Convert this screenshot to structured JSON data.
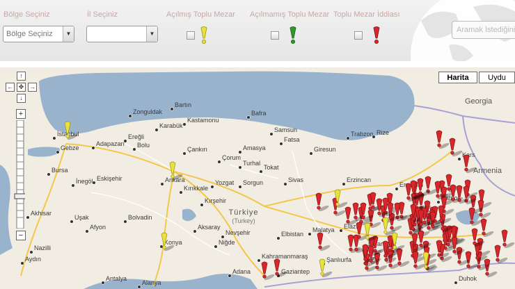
{
  "filters": {
    "region_label": "Bölge Seçiniz",
    "region_value": "Bölge Seçiniz",
    "province_label": "İl Seçiniz",
    "province_value": "",
    "opened_label": "Açılmış Toplu Mezar",
    "unopened_label": "Açılmamış Toplu Mezar",
    "claim_label": "Toplu Mezar İddiası"
  },
  "search": {
    "placeholder": "Aramak İstediğiniz"
  },
  "map_type": {
    "map_label": "Harita",
    "satellite_label": "Uydu"
  },
  "colors": {
    "opened_pin": "#e8e23a",
    "unopened_pin": "#2e9a2e",
    "claim_pin": "#d8262b",
    "sea": "#99b3cc",
    "land": "#f1ede3"
  },
  "map": {
    "cities": {
      "zonguldak": "Zonguldak",
      "bartin": "Bartın",
      "kastamonu": "Kastamonu",
      "bafra": "Bafra",
      "karabuk": "Karabük",
      "samsun": "Samsun",
      "istanbul": "İstanbul",
      "adapazari": "Adapazarı",
      "eregli": "Ereğli",
      "bolu": "Bolu",
      "cankiri": "Çankırı",
      "amasya": "Amasya",
      "fatsa": "Fatsa",
      "giresun": "Giresun",
      "trabzon": "Trabzon",
      "rize": "Rize",
      "gebze": "Gebze",
      "bursa": "Bursa",
      "corum": "Çorum",
      "turhal": "Turhal",
      "tokat": "Tokat",
      "inegol": "İnegöl",
      "eskisehir": "Eskişehir",
      "ankara": "Ankara",
      "kirikkale": "Kırıkkale",
      "yozgat": "Yozgat",
      "sorgun": "Sorgun",
      "sivas": "Sivas",
      "erzincan": "Erzincan",
      "erzurum": "Erzurum",
      "kirsehir": "Kırşehir",
      "usak": "Uşak",
      "afyon": "Afyon",
      "akhisar": "Akhisar",
      "bolvadin": "Bolvadin",
      "aksaray": "Aksaray",
      "nevsehir": "Nevşehir",
      "malatya": "Malatya",
      "elazig": "Elazığ",
      "nazilli": "Nazilli",
      "konya": "Konya",
      "nigde": "Niğde",
      "elbistan": "Elbistan",
      "aydin": "Aydın",
      "kahramanmaras": "Kahramanmaraş",
      "diyarbakir": "Diyarbakır",
      "adana": "Adana",
      "gaziantep": "Gaziantep",
      "sanliurfa": "Şanlıurfa",
      "antalya": "Antalya",
      "alanya": "Alanya",
      "dohuk": "Duhok",
      "patnos": "Patnos",
      "kars": "Kars",
      "georgia": "Georgia",
      "armenia": "Armenia",
      "turkiye": "Türkiye",
      "turkey": "(Turkey)"
    }
  }
}
